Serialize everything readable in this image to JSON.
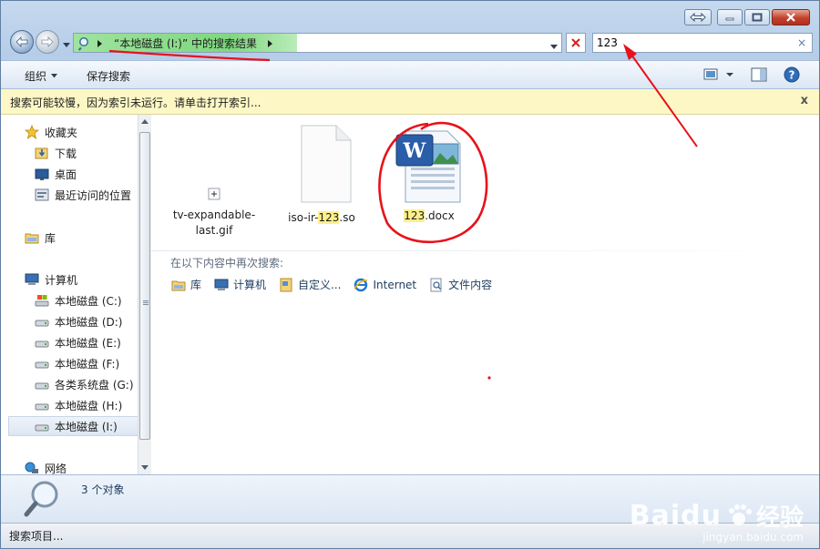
{
  "address": {
    "breadcrumb": "“本地磁盘 (I:)” 中的搜索结果"
  },
  "search": {
    "query": "123",
    "clear": "×"
  },
  "toolbar": {
    "organize": "组织",
    "save_search": "保存搜索"
  },
  "infobar": {
    "message": "搜索可能较慢，因为索引未运行。请单击打开索引...",
    "close": "x"
  },
  "sidebar": {
    "favorites": "收藏夹",
    "downloads": "下载",
    "desktop": "桌面",
    "recent": "最近访问的位置",
    "libraries": "库",
    "computer": "计算机",
    "drives": [
      {
        "label": "本地磁盘 (C:)"
      },
      {
        "label": "本地磁盘 (D:)"
      },
      {
        "label": "本地磁盘 (E:)"
      },
      {
        "label": "本地磁盘 (F:)"
      },
      {
        "label": "各类系统盘 (G:)"
      },
      {
        "label": "本地磁盘 (H:)"
      },
      {
        "label": "本地磁盘 (I:)"
      }
    ],
    "network": "网络"
  },
  "files": [
    {
      "line1": "tv-expandable-",
      "line2": "last.gif"
    },
    {
      "pre": "iso-ir-",
      "match": "123",
      "post": ".so"
    },
    {
      "pre": "",
      "match": "123",
      "post": ".docx"
    }
  ],
  "search_again": {
    "label": "在以下内容中再次搜索:",
    "options": [
      "库",
      "计算机",
      "自定义...",
      "Internet",
      "文件内容"
    ]
  },
  "details": {
    "count": "3 个对象"
  },
  "status": {
    "text": "搜索项目..."
  },
  "watermark": {
    "brand": "Baidu",
    "brand_cn": "经验",
    "url": "jingyan.baidu.com"
  },
  "colors": {
    "annotation_red": "#e8111a",
    "address_highlight": "#7fd77f",
    "match_highlight": "#ffef8a"
  }
}
